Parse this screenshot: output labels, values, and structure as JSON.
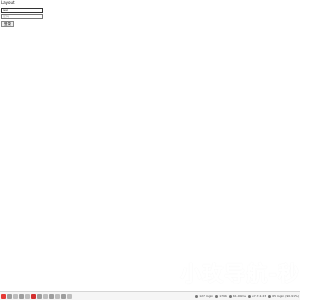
{
  "login": {
    "title": "Layout",
    "username_value": "test",
    "password_placeholder": "密码",
    "submit_label": "登录"
  },
  "brand": {
    "text": "小玫导航-秒"
  },
  "taskbar": {
    "icons": [
      {
        "name": "app-red-icon",
        "color": "#e53935"
      },
      {
        "name": "app-gray-icon",
        "color": "#9e9e9e"
      },
      {
        "name": "app-gray-icon",
        "color": "#bdbdbd"
      },
      {
        "name": "app-gray-icon",
        "color": "#9e9e9e"
      },
      {
        "name": "app-gray-icon",
        "color": "#bdbdbd"
      },
      {
        "name": "app-red-icon",
        "color": "#d32f2f"
      },
      {
        "name": "app-gray-icon",
        "color": "#9e9e9e"
      },
      {
        "name": "app-gray-icon",
        "color": "#bdbdbd"
      },
      {
        "name": "app-gray-icon",
        "color": "#9e9e9e"
      },
      {
        "name": "app-gray-icon",
        "color": "#bdbdbd"
      },
      {
        "name": "app-gray-icon",
        "color": "#9e9e9e"
      },
      {
        "name": "app-gray-icon",
        "color": "#bdbdbd"
      }
    ],
    "status_items": [
      {
        "label": "127 login",
        "icon": "user-icon",
        "color": "#444"
      },
      {
        "label": "179K",
        "icon": "memory-icon",
        "color": "#444"
      },
      {
        "label": "61.00ms",
        "icon": "timer-icon",
        "color": "#444"
      },
      {
        "label": "v7.7.2.23",
        "icon": "version-icon",
        "color": "#444"
      },
      {
        "label": "65 login (90.91%)",
        "icon": "check-icon",
        "color": "#444"
      }
    ]
  }
}
